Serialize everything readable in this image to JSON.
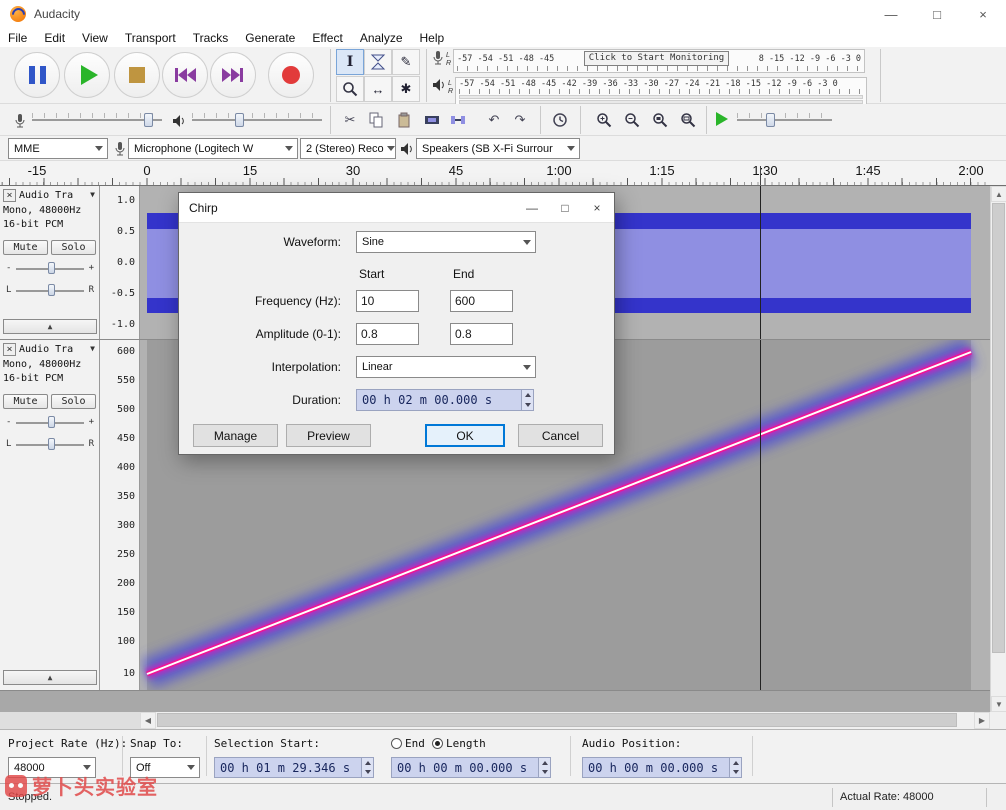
{
  "window": {
    "title": "Audacity"
  },
  "glyphs": {
    "minimize": "—",
    "maximize": "□",
    "close": "×",
    "dropdown": "▼",
    "collapse": "▲",
    "track_close": "×",
    "scroll_left": "◀",
    "scroll_right": "▶",
    "scroll_up": "▲",
    "scroll_down": "▼",
    "minus": "-",
    "plus": "+",
    "left": "L",
    "right": "R"
  },
  "icon_glyphs": {
    "selection": "I",
    "draw": "✎",
    "timeshift": "↔",
    "multi": "✱",
    "cut": "✂",
    "undo": "↶",
    "redo": "↷"
  },
  "menubar": {
    "items": [
      "File",
      "Edit",
      "View",
      "Transport",
      "Tracks",
      "Generate",
      "Effect",
      "Analyze",
      "Help"
    ]
  },
  "meters": {
    "channel_left": "L",
    "channel_right": "R",
    "record_left": "-57 -54 -51 -48 -45",
    "monitor": "Click to Start Monitoring",
    "record_right": "8 -15 -12 -9 -6 -3 0",
    "playback_scale": "-57 -54 -51 -48 -45 -42 -39 -36 -33 -30 -27 -24 -21 -18 -15 -12 -9 -6 -3 0"
  },
  "device_toolbar": {
    "host": "MME",
    "recording_device": "Microphone (Logitech W",
    "recording_channels": "2 (Stereo) Reco",
    "playback_device": "Speakers (SB X-Fi Surrour"
  },
  "timeline": {
    "labels": [
      "-15",
      "0",
      "15",
      "30",
      "45",
      "1:00",
      "1:15",
      "1:30",
      "1:45",
      "2:00"
    ]
  },
  "tracks": [
    {
      "name": "Audio Tra",
      "info1": "Mono, 48000Hz",
      "info2": "16-bit PCM",
      "mute": "Mute",
      "solo": "Solo",
      "ruler": [
        "1.0",
        "0.5",
        "0.0",
        "-0.5",
        "-1.0"
      ]
    },
    {
      "name": "Audio Tra",
      "info1": "Mono, 48000Hz",
      "info2": "16-bit PCM",
      "mute": "Mute",
      "solo": "Solo",
      "ruler": [
        "600",
        "550",
        "500",
        "450",
        "400",
        "350",
        "300",
        "250",
        "200",
        "150",
        "100",
        "10"
      ]
    }
  ],
  "dialog": {
    "title": "Chirp",
    "waveform_label": "Waveform:",
    "waveform_value": "Sine",
    "start_label": "Start",
    "end_label": "End",
    "frequency_label": "Frequency (Hz):",
    "frequency_start": "10",
    "frequency_end": "600",
    "amplitude_label": "Amplitude (0-1):",
    "amplitude_start": "0.8",
    "amplitude_end": "0.8",
    "interpolation_label": "Interpolation:",
    "interpolation_value": "Linear",
    "duration_label": "Duration:",
    "duration_value": "00 h 02 m 00.000 s",
    "manage": "Manage",
    "preview": "Preview",
    "ok": "OK",
    "cancel": "Cancel"
  },
  "selection_toolbar": {
    "project_rate_label": "Project Rate (Hz):",
    "project_rate_value": "48000",
    "snap_label": "Snap To:",
    "snap_value": "Off",
    "selection_start_label": "Selection Start:",
    "selection_start_value": "00 h 01 m 29.346 s",
    "end_label": "End",
    "length_label": "Length",
    "length_value": "00 h 00 m 00.000 s",
    "audio_position_label": "Audio Position:",
    "audio_position_value": "00 h 00 m 00.000 s"
  },
  "statusbar": {
    "status": "Stopped.",
    "actual_rate": "Actual Rate: 48000"
  },
  "watermark": {
    "text": "萝卜头实验室"
  },
  "colors": {
    "accent": "#0078d7",
    "waveform": "#3434cb",
    "waveform_rms": "#8f8fe2",
    "record_red": "#e23b3b",
    "play_green": "#2ab52a",
    "pause_blue": "#3056c8",
    "stop_brown": "#bf9540",
    "skip_purple": "#8a3ca0",
    "chirp_core": "#ffffff",
    "chirp_pink": "#ee1493",
    "chirp_glow": "#4848d8",
    "timecode_bg": "#ccd3ee"
  }
}
